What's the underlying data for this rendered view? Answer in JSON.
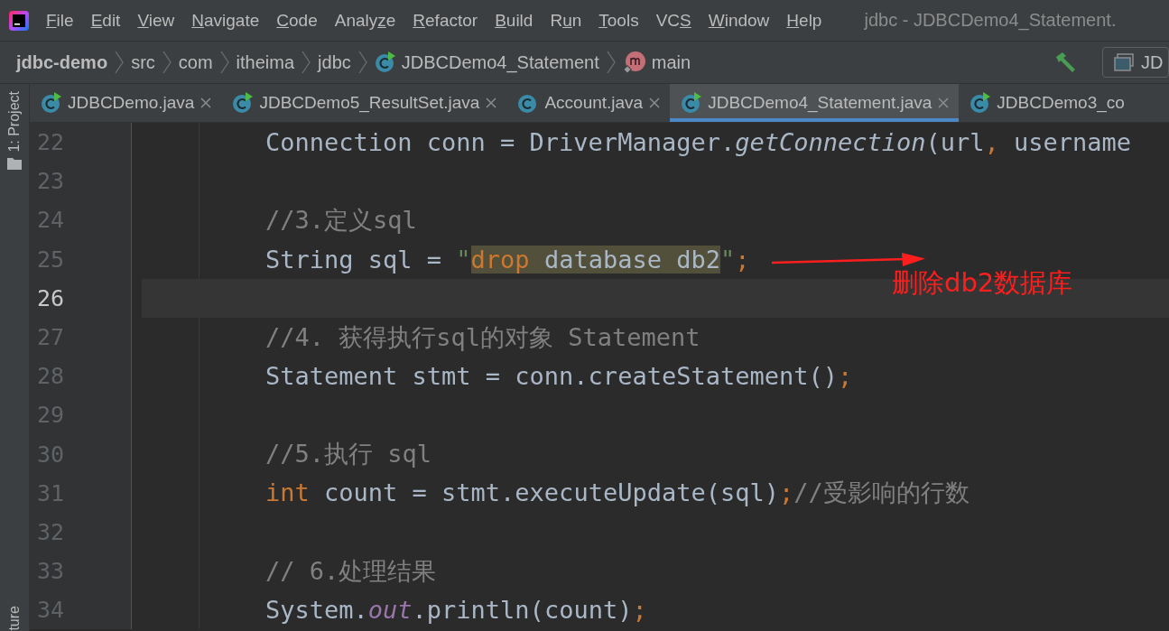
{
  "menu_bar": {
    "items": [
      {
        "key": "F",
        "post": "ile"
      },
      {
        "key": "E",
        "post": "dit"
      },
      {
        "key": "V",
        "post": "iew"
      },
      {
        "key": "N",
        "post": "avigate"
      },
      {
        "key": "C",
        "post": "ode"
      },
      {
        "pre": "Analy",
        "key": "z",
        "post": "e"
      },
      {
        "key": "R",
        "post": "efactor"
      },
      {
        "key": "B",
        "post": "uild"
      },
      {
        "pre": "R",
        "key": "u",
        "post": "n"
      },
      {
        "key": "T",
        "post": "ools"
      },
      {
        "pre": "VC",
        "key": "S"
      },
      {
        "key": "W",
        "post": "indow"
      },
      {
        "key": "H",
        "post": "elp"
      }
    ],
    "title": "jdbc - JDBCDemo4_Statement."
  },
  "breadcrumbs": [
    {
      "label": "jdbc-demo",
      "kind": "project"
    },
    {
      "label": "src",
      "kind": "folder"
    },
    {
      "label": "com",
      "kind": "folder"
    },
    {
      "label": "itheima",
      "kind": "folder"
    },
    {
      "label": "jdbc",
      "kind": "folder"
    },
    {
      "label": "JDBCDemo4_Statement",
      "kind": "class"
    },
    {
      "label": "main",
      "kind": "method"
    }
  ],
  "run_config": {
    "label": "JD"
  },
  "tabs": [
    {
      "label": "JDBCDemo.java",
      "runnable": true,
      "selected": false,
      "close_visible": true
    },
    {
      "label": "JDBCDemo5_ResultSet.java",
      "runnable": true,
      "selected": false,
      "close_visible": true
    },
    {
      "label": "Account.java",
      "runnable": false,
      "selected": false,
      "close_visible": true
    },
    {
      "label": "JDBCDemo4_Statement.java",
      "runnable": true,
      "selected": true,
      "close_visible": true
    },
    {
      "label": "JDBCDemo3_co",
      "runnable": true,
      "selected": false,
      "close_visible": false
    }
  ],
  "tool_windows": [
    {
      "label": "1: Project"
    },
    {
      "label": "ture"
    }
  ],
  "editor": {
    "lines": [
      {
        "number": "22",
        "current": false,
        "tokens": [
          {
            "kind": "plain",
            "text": "Connection conn = DriverManager."
          },
          {
            "kind": "call",
            "text": "getConnection"
          },
          {
            "kind": "plain",
            "text": "(url"
          },
          {
            "kind": "keyword",
            "text": ","
          },
          {
            "kind": "plain",
            "text": " username"
          }
        ]
      },
      {
        "number": "23",
        "current": false
      },
      {
        "number": "24",
        "current": false,
        "tokens": [
          {
            "kind": "comment",
            "text": "//3.定义sql"
          }
        ]
      },
      {
        "number": "25",
        "current": false,
        "tokens": [
          {
            "kind": "plain",
            "text": "String sql = "
          },
          {
            "kind": "string",
            "text": "\""
          },
          {
            "kind": "match_keyword",
            "text": "drop"
          },
          {
            "kind": "match_plain",
            "text": " database db2"
          },
          {
            "kind": "string",
            "text": "\""
          },
          {
            "kind": "keyword",
            "text": ";"
          }
        ]
      },
      {
        "number": "26",
        "current": true
      },
      {
        "number": "27",
        "current": false,
        "tokens": [
          {
            "kind": "comment",
            "text": "//4. 获得执行sql的对象 Statement"
          }
        ]
      },
      {
        "number": "28",
        "current": false,
        "tokens": [
          {
            "kind": "plain",
            "text": "Statement stmt = conn.createStatement()"
          },
          {
            "kind": "keyword",
            "text": ";"
          }
        ]
      },
      {
        "number": "29",
        "current": false
      },
      {
        "number": "30",
        "current": false,
        "tokens": [
          {
            "kind": "comment",
            "text": "//5.执行 sql"
          }
        ]
      },
      {
        "number": "31",
        "current": false,
        "tokens": [
          {
            "kind": "keyword",
            "text": "int"
          },
          {
            "kind": "plain",
            "text": " count = stmt.executeUpdate(sql)"
          },
          {
            "kind": "keyword",
            "text": ";"
          },
          {
            "kind": "comment",
            "text": "//受影响的行数"
          }
        ]
      },
      {
        "number": "32",
        "current": false
      },
      {
        "number": "33",
        "current": false,
        "tokens": [
          {
            "kind": "comment",
            "text": "// 6.处理结果"
          }
        ]
      },
      {
        "number": "34",
        "current": false,
        "tokens": [
          {
            "kind": "plain",
            "text": "System."
          },
          {
            "kind": "field",
            "text": "out"
          },
          {
            "kind": "plain",
            "text": ".println(count)"
          },
          {
            "kind": "keyword",
            "text": ";"
          }
        ]
      }
    ]
  },
  "annotation": {
    "text": "删除db2数据库"
  }
}
